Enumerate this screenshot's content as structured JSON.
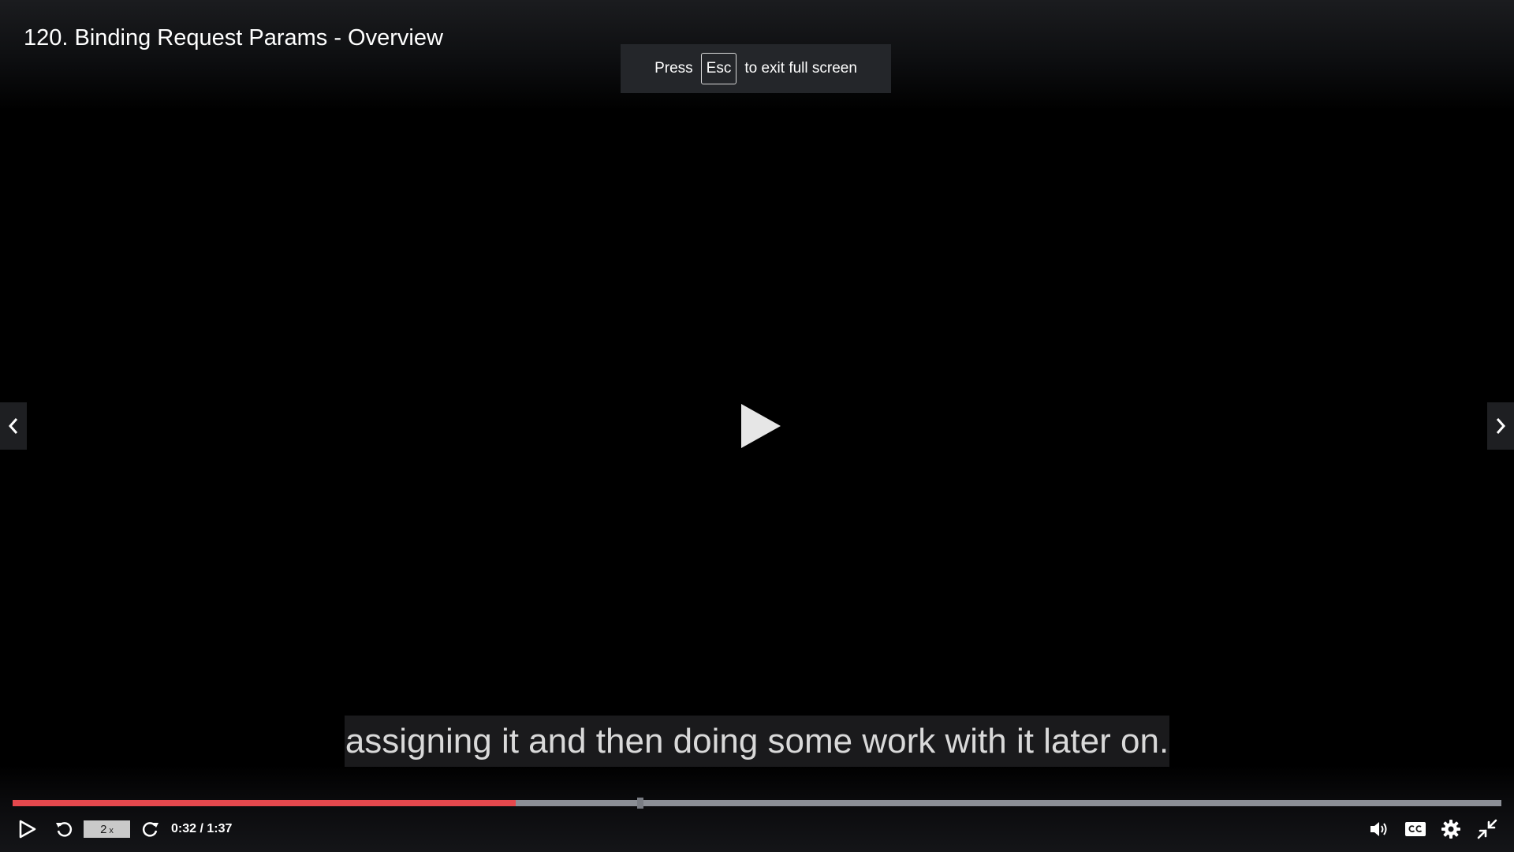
{
  "video": {
    "title": "120. Binding Request Params - Overview",
    "caption": "assigning it and then doing some work with it later on."
  },
  "fullscreen_notice": {
    "press": "Press",
    "key": "Esc",
    "suffix": "to exit full screen"
  },
  "player": {
    "current_time": "0:32",
    "duration": "1:37",
    "time_separator": " / ",
    "progress_fraction": 0.338,
    "speed_value": "2",
    "speed_suffix": "x"
  },
  "icons": {
    "prev": "chevron-left-icon",
    "next": "chevron-right-icon",
    "center": "play-icon",
    "play": "play-icon",
    "rewind": "rewind-icon",
    "forward": "forward-icon",
    "volume": "volume-icon",
    "captions": "captions-icon",
    "settings": "gear-icon",
    "exit_fullscreen": "exit-fullscreen-icon"
  },
  "colors": {
    "progress_played": "#e5484d",
    "progress_track": "#8c8f96",
    "caption_text": "#d9d9d9"
  }
}
